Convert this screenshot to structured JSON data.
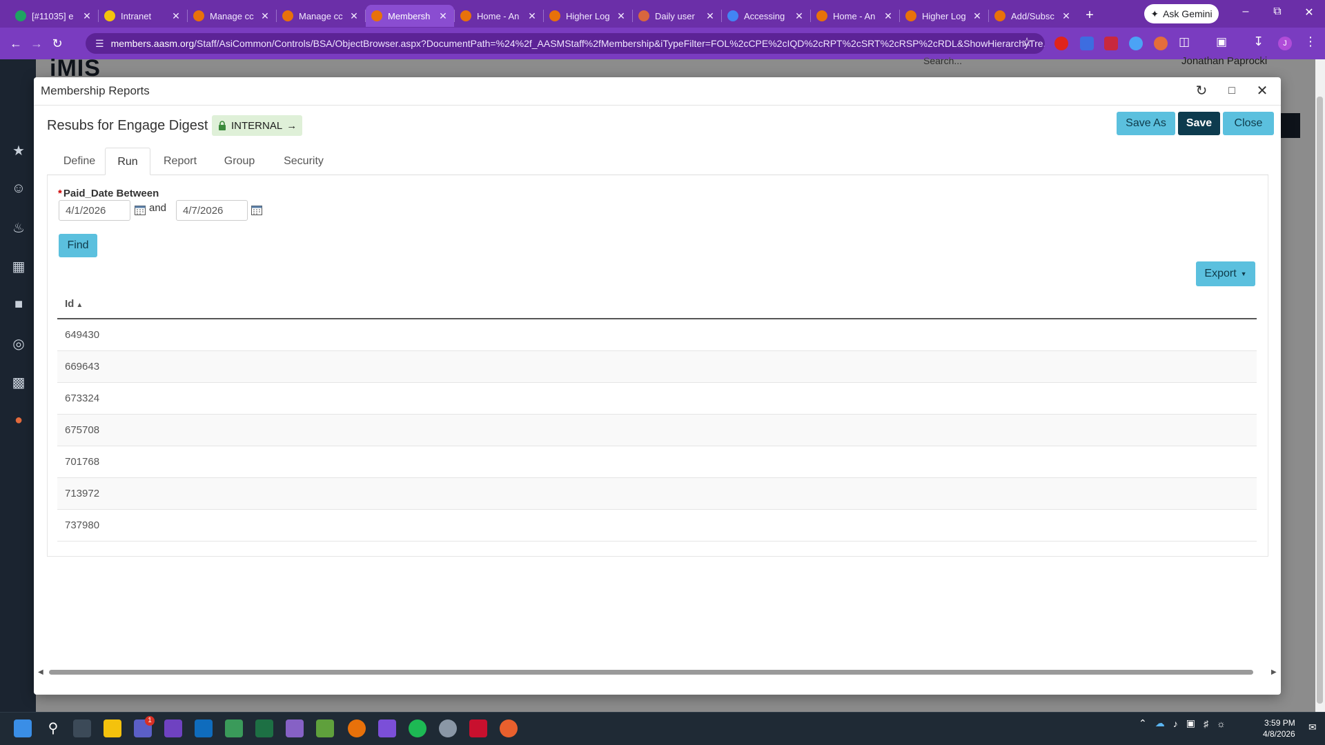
{
  "browser": {
    "tabs": [
      {
        "title": "[#11035] e",
        "icon_color": "#1ea362"
      },
      {
        "title": "Intranet",
        "icon_color": "#f4c20d"
      },
      {
        "title": "Manage cc",
        "icon_color": "#e8710a"
      },
      {
        "title": "Manage cc",
        "icon_color": "#e8710a"
      },
      {
        "title": "Membersh",
        "icon_color": "#e8710a"
      },
      {
        "title": "Home - An",
        "icon_color": "#e8710a"
      },
      {
        "title": "Higher Log",
        "icon_color": "#e8710a"
      },
      {
        "title": "Daily user",
        "icon_color": "#d9663e"
      },
      {
        "title": "Accessing",
        "icon_color": "#4285f4"
      },
      {
        "title": "Home - An",
        "icon_color": "#e8710a"
      },
      {
        "title": "Higher Log",
        "icon_color": "#e8710a"
      },
      {
        "title": "Add/Subsc",
        "icon_color": "#e8710a"
      }
    ],
    "active_tab_index": 4,
    "new_tab_label": "+",
    "gemini_label": "Ask Gemini",
    "url_host": "members.aasm.org",
    "url_path": "/Staff/AsiCommon/Controls/BSA/ObjectBrowser.aspx?DocumentPath=%24%2f_AASMStaff%2fMembership&iTypeFilter=FOL%2cCPE%2cIQD%2cRPT%2cSRT%2cRSP%2cRDL&ShowHierarchyTre..."
  },
  "background_page": {
    "logo": "iMIS",
    "search_placeholder": "Search...",
    "user_name": "Jonathan Paprocki"
  },
  "modal": {
    "title": "Membership Reports",
    "report_name": "Resubs for Engage Digest",
    "status_badge": "INTERNAL",
    "buttons": {
      "save_as": "Save As",
      "save": "Save",
      "close": "Close"
    },
    "tabs": [
      "Define",
      "Run",
      "Report",
      "Group",
      "Security"
    ],
    "active_tab": "Run",
    "parameter": {
      "label": "Paid_Date Between",
      "required_marker": "*",
      "from_value": "4/1/2026",
      "and_label": "and",
      "to_value": "4/7/2026"
    },
    "find_label": "Find",
    "export_label": "Export",
    "table": {
      "column": "Id",
      "sort": "ascending",
      "rows": [
        "649430",
        "669643",
        "673324",
        "675708",
        "701768",
        "713972",
        "737980"
      ]
    }
  },
  "taskbar": {
    "notification_count": "1",
    "time": "3:59 PM",
    "date": "4/8/2026"
  }
}
